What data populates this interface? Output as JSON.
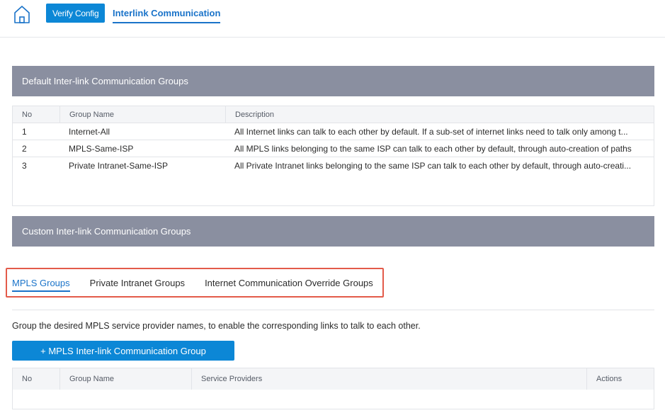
{
  "topbar": {
    "verify_label": "Verify Config",
    "active_tab": "Interlink Communication"
  },
  "default_groups": {
    "title": "Default Inter-link Communication Groups",
    "columns": [
      "No",
      "Group Name",
      "Description"
    ],
    "rows": [
      {
        "no": "1",
        "name": "Internet-All",
        "description": "All Internet links can talk to each other by default. If a sub-set of internet links need to talk only among t..."
      },
      {
        "no": "2",
        "name": "MPLS-Same-ISP",
        "description": "All MPLS links belonging to the same ISP can talk to each other by default, through auto-creation of paths"
      },
      {
        "no": "3",
        "name": "Private Intranet-Same-ISP",
        "description": "All Private Intranet links belonging to the same ISP can talk to each other by default, through auto-creati..."
      }
    ]
  },
  "custom_groups": {
    "title": "Custom Inter-link Communication Groups",
    "tabs": [
      "MPLS Groups",
      "Private Intranet Groups",
      "Internet Communication Override Groups"
    ],
    "help_text": "Group the desired MPLS service provider names, to enable the corresponding links to talk to each other.",
    "add_button": "+ MPLS Inter-link Communication Group",
    "columns": [
      "No",
      "Group Name",
      "Service Providers",
      "Actions"
    ]
  },
  "colors": {
    "accent": "#0c87d6",
    "header_bg": "#8a8fa0",
    "highlight": "#e35b4a"
  }
}
